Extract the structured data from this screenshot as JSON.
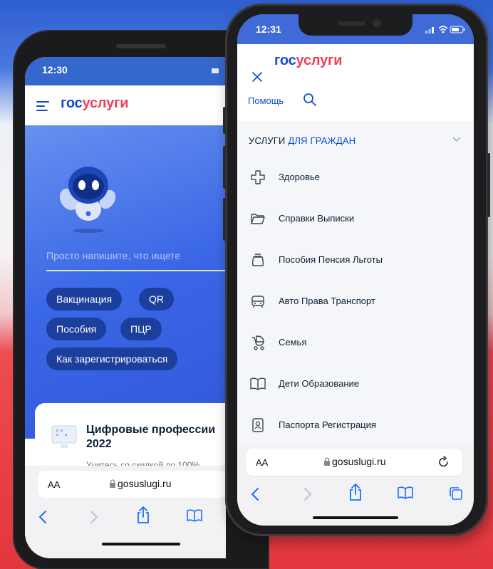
{
  "left_phone": {
    "status_time": "12:30",
    "logo_part1": "гос",
    "logo_part2": "услуги",
    "search_placeholder": "Просто напишите, что ищете",
    "chips": [
      "Вакцинация",
      "QR",
      "Пособия",
      "ПЦР",
      "Как зарегистрироваться"
    ],
    "card_title": "Цифровые профессии 2022",
    "card_subtitle": "Учитесь со скидкой до 100%",
    "aa_label": "AA",
    "url": "gosuslugi.ru"
  },
  "right_phone": {
    "status_time": "12:31",
    "logo_part1": "гос",
    "logo_part2": "услуги",
    "help_label": "Помощь",
    "services_prefix": "УСЛУГИ",
    "services_link": "ДЛЯ ГРАЖДАН",
    "menu_items": [
      {
        "label": "Здоровье",
        "icon": "health-cross-icon"
      },
      {
        "label": "Справки Выписки",
        "icon": "folder-icon"
      },
      {
        "label": "Пособия Пенсия Льготы",
        "icon": "piggy-bank-icon"
      },
      {
        "label": "Авто Права Транспорт",
        "icon": "car-icon"
      },
      {
        "label": "Семья",
        "icon": "stroller-icon"
      },
      {
        "label": "Дети Образование",
        "icon": "book-icon"
      },
      {
        "label": "Паспорта Регистрация",
        "icon": "passport-icon"
      }
    ],
    "aa_label": "AA",
    "url": "gosuslugi.ru"
  },
  "colors": {
    "brand_blue": "#0d4cd3",
    "brand_red": "#ee3f58",
    "chip_bg": "#1c3f9e"
  }
}
